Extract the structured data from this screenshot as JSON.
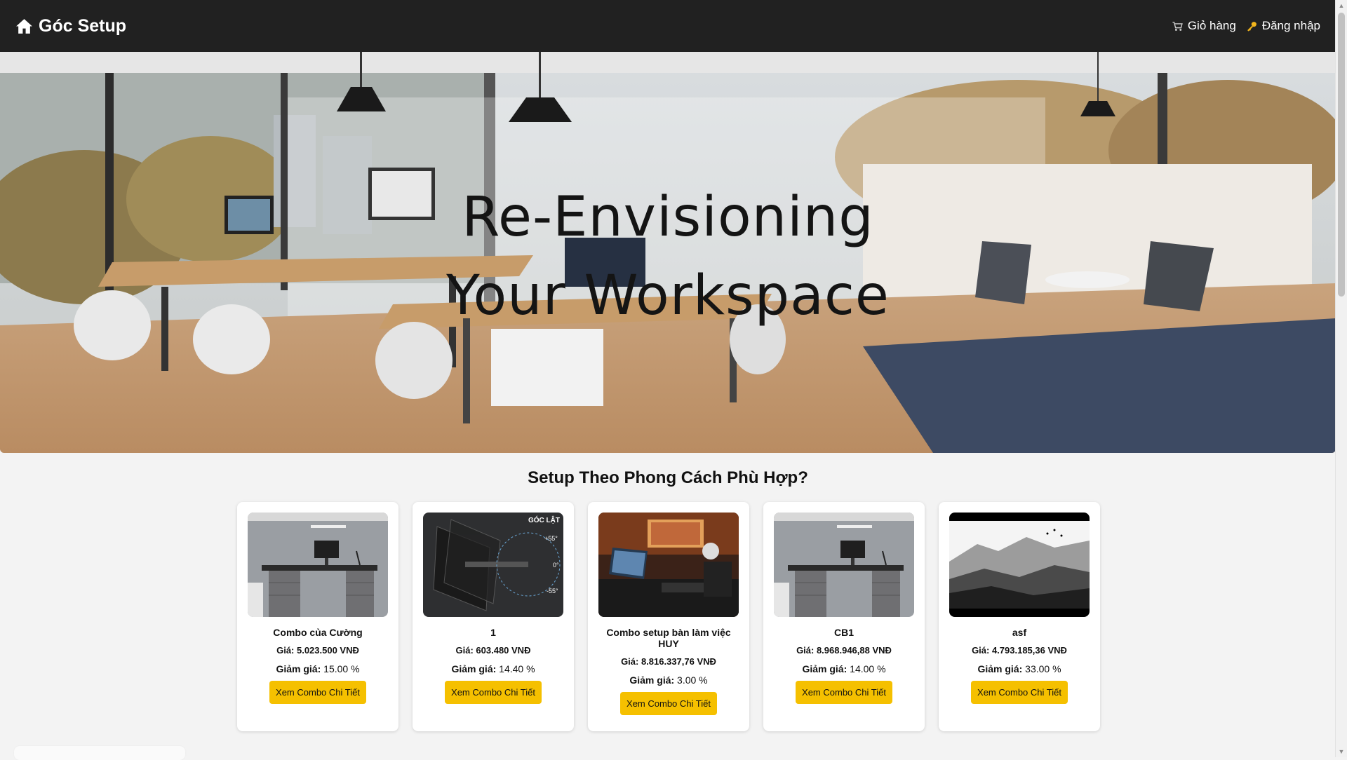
{
  "navbar": {
    "brand": "Góc Setup",
    "brand_icon": "home-icon",
    "cart_label": "Giỏ hàng",
    "cart_icon": "cart-icon",
    "login_label": "Đăng nhập",
    "login_icon": "key-icon"
  },
  "hero": {
    "title_line1": "Re-Envisioning",
    "title_line2": "Your Workspace"
  },
  "section": {
    "title": "Setup Theo Phong Cách Phù Hợp?"
  },
  "combos": [
    {
      "name": "Combo của Cường",
      "price": "Giá: 5.023.500 VNĐ",
      "discount_label": "Giảm giá:",
      "discount_value": "15.00 %",
      "button": "Xem Combo Chi Tiết",
      "thumb": "office-desk"
    },
    {
      "name": "1",
      "price": "Giá: 603.480 VNĐ",
      "discount_label": "Giảm giá:",
      "discount_value": "14.40 %",
      "button": "Xem Combo Chi Tiết",
      "thumb": "monitor-arm",
      "thumb_text": [
        "GÓC LẬT",
        "+55°",
        "0°",
        "-55°"
      ]
    },
    {
      "name": "Combo setup bàn làm việc HUY",
      "price": "Giá: 8.816.337,76 VNĐ",
      "discount_label": "Giảm giá:",
      "discount_value": "3.00 %",
      "button": "Xem Combo Chi Tiết",
      "thumb": "gaming-desk"
    },
    {
      "name": "CB1",
      "price": "Giá: 8.968.946,88 VNĐ",
      "discount_label": "Giảm giá:",
      "discount_value": "14.00 %",
      "button": "Xem Combo Chi Tiết",
      "thumb": "office-desk"
    },
    {
      "name": "asf",
      "price": "Giá: 4.793.185,36 VNĐ",
      "discount_label": "Giảm giá:",
      "discount_value": "33.00 %",
      "button": "Xem Combo Chi Tiết",
      "thumb": "sketch-landscape"
    }
  ],
  "colors": {
    "navbar_bg": "#212121",
    "button_bg": "#f5c000",
    "page_bg": "#f3f3f3"
  }
}
